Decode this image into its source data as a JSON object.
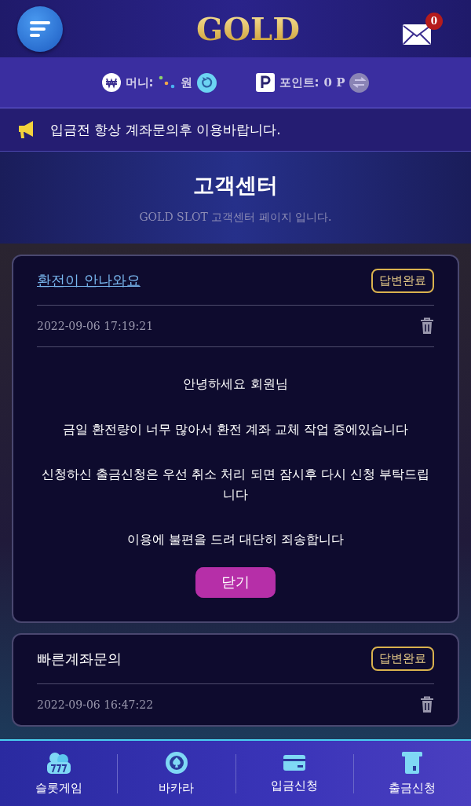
{
  "header": {
    "logo": "GOLD",
    "mail_count": "0"
  },
  "balance": {
    "money_label": "머니:",
    "money_unit": "원",
    "points_label": "포인트:",
    "points_value": "0 P"
  },
  "notice": "입금전 항상 계좌문의후 이용바랍니다.",
  "banner": {
    "title": "고객센터",
    "subtitle": "GOLD SLOT 고객센터 페이지 입니다."
  },
  "inquiries": [
    {
      "title": "환전이 안나와요",
      "status": "답변완료",
      "date": "2022-09-06 17:19:21",
      "expanded": true,
      "answer": [
        "안녕하세요 회원님",
        "금일 환전량이 너무 많아서 환전 계좌 교체 작업 중에있습니다",
        "신청하신 출금신청은 우선 취소 처리 되면 잠시후 다시 신청 부탁드립니다",
        "이용에 불편을 드려 대단히 죄송합니다"
      ],
      "close_label": "닫기"
    },
    {
      "title": "빠른계좌문의",
      "status": "답변완료",
      "date": "2022-09-06 16:47:22",
      "expanded": false
    }
  ],
  "bottom_nav": [
    {
      "kind": "slot",
      "label": "슬롯게임"
    },
    {
      "kind": "chip",
      "label": "바카라"
    },
    {
      "kind": "card",
      "label": "입금신청"
    },
    {
      "kind": "atm",
      "label": "출금신청"
    }
  ]
}
